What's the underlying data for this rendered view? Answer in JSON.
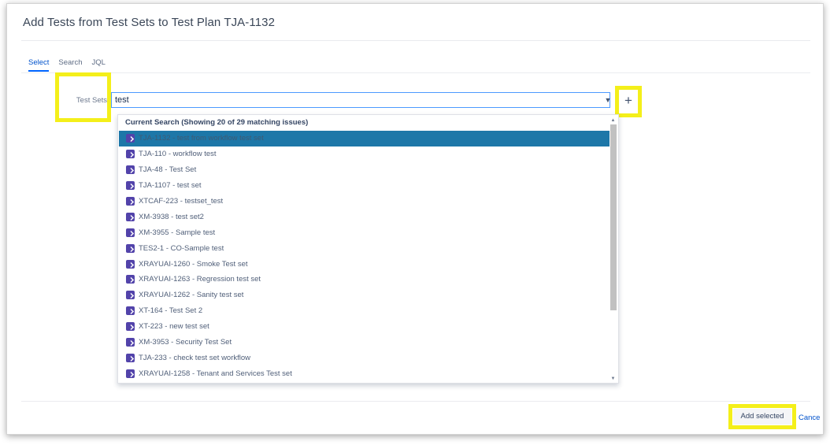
{
  "dialog": {
    "title": "Add Tests from Test Sets to Test Plan TJA-1132"
  },
  "tabs": [
    {
      "label": "Select",
      "active": true
    },
    {
      "label": "Search",
      "active": false
    },
    {
      "label": "JQL",
      "active": false
    }
  ],
  "field": {
    "label": "Test Sets",
    "value": "test",
    "dropdown_icon": "chevron-down-icon",
    "add_icon": "plus-icon",
    "add_symbol": "+"
  },
  "results": {
    "header": "Current Search (Showing 20 of 29 matching issues)",
    "items": [
      {
        "text": "TJA-1132 - test from workflow test set",
        "selected": true
      },
      {
        "text": "TJA-110 - workflow test",
        "selected": false
      },
      {
        "text": "TJA-48 - Test Set",
        "selected": false
      },
      {
        "text": "TJA-1107 - test set",
        "selected": false
      },
      {
        "text": "XTCAF-223 - testset_test",
        "selected": false
      },
      {
        "text": "XM-3938 - test set2",
        "selected": false
      },
      {
        "text": "XM-3955 - Sample test",
        "selected": false
      },
      {
        "text": "TES2-1 - CO-Sample test",
        "selected": false
      },
      {
        "text": "XRAYUAI-1260 - Smoke Test set",
        "selected": false
      },
      {
        "text": "XRAYUAI-1263 - Regression test set",
        "selected": false
      },
      {
        "text": "XRAYUAI-1262 - Sanity test set",
        "selected": false
      },
      {
        "text": "XT-164 - Test Set 2",
        "selected": false
      },
      {
        "text": "XT-223 - new test set",
        "selected": false
      },
      {
        "text": "XM-3953 - Security Test Set",
        "selected": false
      },
      {
        "text": "TJA-233 - check test set workflow",
        "selected": false
      },
      {
        "text": "XRAYUAI-1258 - Tenant and Services Test set",
        "selected": false
      }
    ]
  },
  "footer": {
    "add_selected_label": "Add selected",
    "cancel_label": "Cance"
  },
  "colors": {
    "highlight": "#f4ef1a",
    "selected_row": "#1d77a8",
    "link": "#0052cc",
    "issue_icon": "#5243aa"
  }
}
